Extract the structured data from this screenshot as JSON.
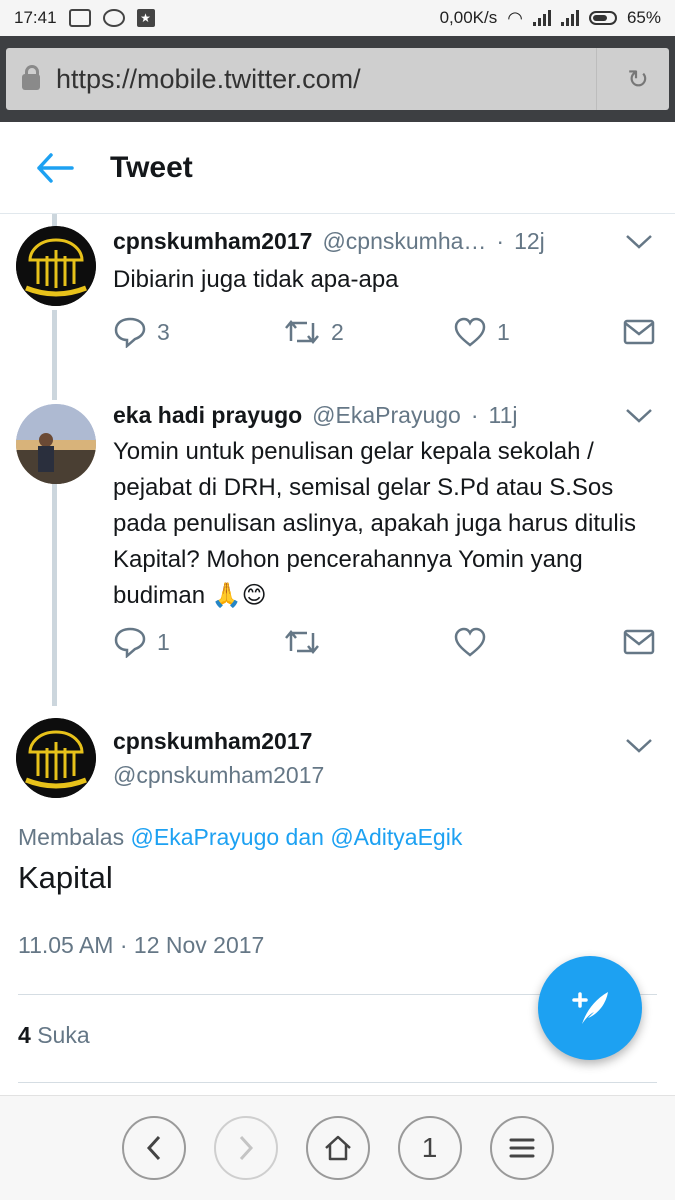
{
  "status_bar": {
    "time": "17:41",
    "network_speed": "0,00K/s",
    "battery": "65%"
  },
  "browser": {
    "url": "https://mobile.twitter.com/"
  },
  "header": {
    "title": "Tweet"
  },
  "tweets": [
    {
      "name": "cpnskumham2017",
      "handle": "@cpnskumha…",
      "time": "12j",
      "text": "Dibiarin juga tidak apa-apa",
      "replies": "3",
      "retweets": "2",
      "likes": "1"
    },
    {
      "name": "eka hadi prayugo",
      "handle": "@EkaPrayugo",
      "time": "11j",
      "text": "Yomin untuk penulisan gelar kepala sekolah / pejabat di DRH, semisal gelar S.Pd atau S.Sos pada penulisan aslinya, apakah juga harus ditulis Kapital? Mohon pencerahannya Yomin yang budiman 🙏😊",
      "replies": "1",
      "retweets": "",
      "likes": ""
    }
  ],
  "main_tweet": {
    "name": "cpnskumham2017",
    "handle": "@cpnskumham2017",
    "reply_prefix": "Membalas",
    "mention_1": "@EkaPrayugo",
    "reply_joiner": "dan",
    "mention_2": "@AdityaEgik",
    "text": "Kapital",
    "timestamp": "11.05 AM · 12 Nov 2017",
    "likes_count": "4",
    "likes_label": "Suka"
  },
  "bottom_nav": {
    "tabs_count": "1"
  },
  "colors": {
    "accent": "#1da1f2",
    "muted": "#657786",
    "urlbar_frame": "#3d3f42"
  }
}
